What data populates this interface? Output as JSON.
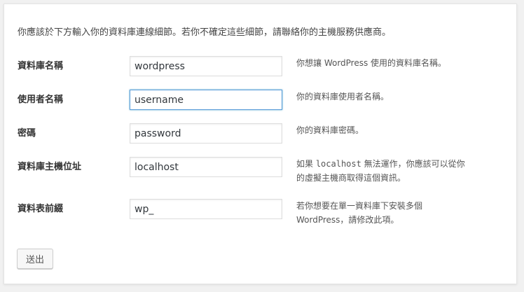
{
  "intro_text": "你應該於下方輸入你的資料庫連線細節。若你不確定這些細節，請聯絡你的主機服務供應商。",
  "fields": [
    {
      "label": "資料庫名稱",
      "value": "wordpress",
      "description": "你想讓 WordPress 使用的資料庫名稱。"
    },
    {
      "label": "使用者名稱",
      "value": "username",
      "description": "你的資料庫使用者名稱。"
    },
    {
      "label": "密碼",
      "value": "password",
      "description": "你的資料庫密碼。"
    },
    {
      "label": "資料庫主機位址",
      "value": "localhost",
      "description_parts": [
        "如果 ",
        "localhost",
        " 無法運作，你應該可以從你",
        "的虛擬主機商取得這個資訊。"
      ]
    },
    {
      "label": "資料表前綴",
      "value": "wp_",
      "description_lines": [
        "若你想要在單一資料庫下安裝多個",
        "WordPress，請修改此項。"
      ]
    }
  ],
  "submit_label": "送出",
  "colors": {
    "page_bg": "#f1f1f1",
    "card_bg": "#ffffff",
    "focus_border": "#5b9dd9"
  }
}
